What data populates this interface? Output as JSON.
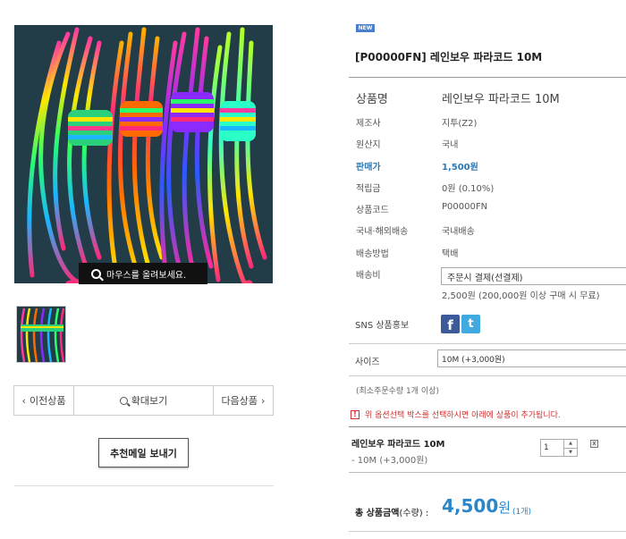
{
  "product": {
    "badge": "NEW",
    "title": "[P00000FN] 레인보우 파라코드 10M",
    "image_hint": "마우스를 올려보세요."
  },
  "navigation": {
    "prev": "이전상품",
    "zoom": "확대보기",
    "next": "다음상품"
  },
  "recommend_mail_button": "추천메일 보내기",
  "info": [
    {
      "label": "상품명",
      "value": "레인보우 파라코드 10M"
    },
    {
      "label": "제조사",
      "value": "지투(Z2)"
    },
    {
      "label": "원산지",
      "value": "국내"
    },
    {
      "label": "판매가",
      "value": "1,500원"
    },
    {
      "label": "적립금",
      "value": "0원 (0.10%)"
    },
    {
      "label": "상품코드",
      "value": "P00000FN"
    },
    {
      "label": "국내·해외배송",
      "value": "국내배송"
    },
    {
      "label": "배송방법",
      "value": "택배"
    },
    {
      "label": "배송비",
      "value": ""
    }
  ],
  "shipping": {
    "select_value": "주문시 결제(선결제)",
    "note": "2,500원 (200,000원 이상 구매 시 무료)"
  },
  "sns": {
    "label": "SNS 상품홍보",
    "facebook_icon": "f",
    "twitter_icon": "t"
  },
  "size": {
    "label": "사이즈",
    "select_value": "10M (+3,000원)"
  },
  "min_order": "(최소주문수량 1개 이상)",
  "notice": {
    "icon": "!",
    "text": "위 옵션선택 박스를 선택하시면 아래에 상품이 추가됩니다."
  },
  "selected_option": {
    "name": "레인보우 파라코드 10M",
    "detail": "- 10M (+3,000원)",
    "quantity": "1",
    "delete_icon": "x"
  },
  "total": {
    "label": "총 상품금액",
    "qty_label": "(수량) :",
    "amount": "4,500",
    "unit": "원",
    "count": "(1개)"
  },
  "colors": {
    "price_blue": "#2a7ab8",
    "total_blue": "#2a86c8",
    "notice_red": "#d03030",
    "new_badge": "#4a7fd0",
    "facebook": "#3b5a9a",
    "twitter": "#3fa9e0"
  }
}
